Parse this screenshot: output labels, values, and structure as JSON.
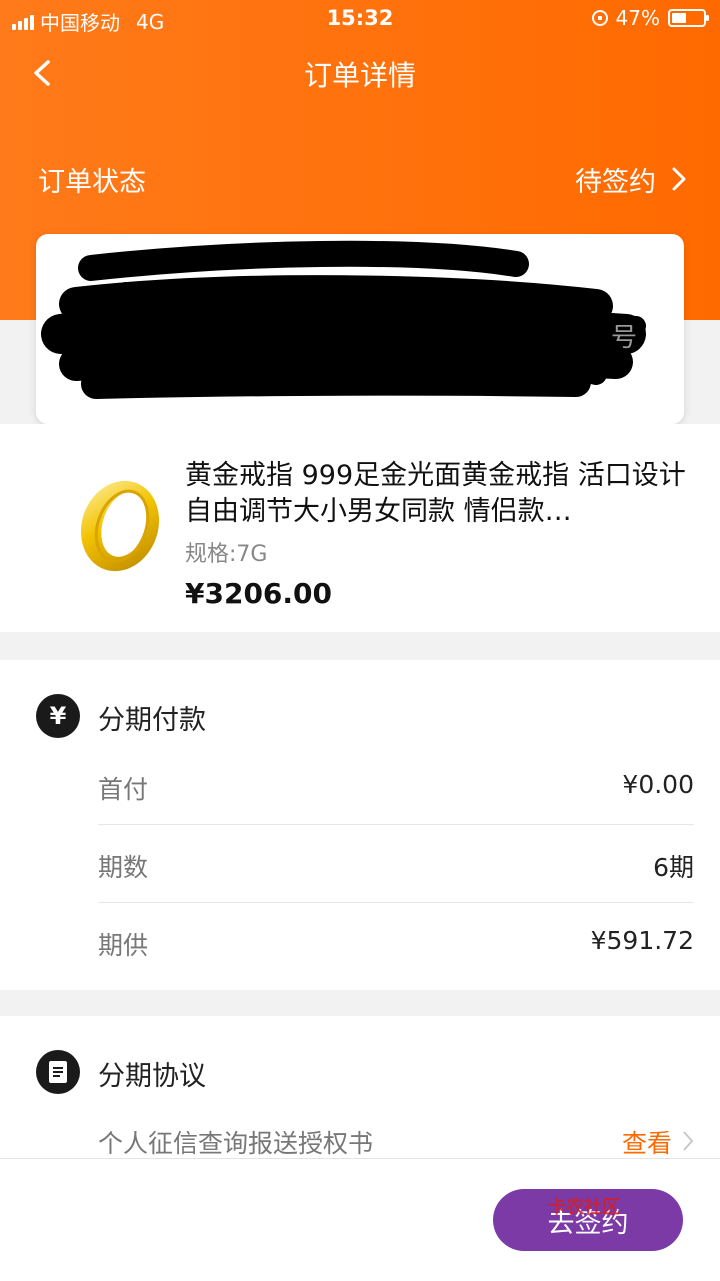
{
  "status_bar": {
    "carrier": "中国移动",
    "network": "4G",
    "time": "15:32",
    "battery": "47%",
    "battery_level": 0.47
  },
  "nav": {
    "title": "订单详情",
    "back_icon": "chevron-left-icon"
  },
  "order_status": {
    "label": "订单状态",
    "value": "待签约"
  },
  "address_card": {
    "redacted": true
  },
  "product": {
    "title": "黄金戒指  999足金光面黄金戒指 活口设计 自由调节大小男女同款 情侣款…",
    "spec": "规格:7G",
    "price": "¥3206.00"
  },
  "installment": {
    "title": "分期付款",
    "icon": "yen-icon",
    "rows": [
      {
        "label": "首付",
        "value": "¥0.00"
      },
      {
        "label": "期数",
        "value": "6期"
      },
      {
        "label": "期供",
        "value": "¥591.72"
      }
    ]
  },
  "agreement": {
    "title": "分期协议",
    "icon": "document-icon",
    "item_label": "个人征信查询报送授权书",
    "item_link": "查看"
  },
  "bottom": {
    "sign_button": "去签约",
    "watermark": "卡农社区"
  },
  "colors": {
    "brand_orange": "#ff6a00",
    "button_purple": "#7b3aa6"
  }
}
